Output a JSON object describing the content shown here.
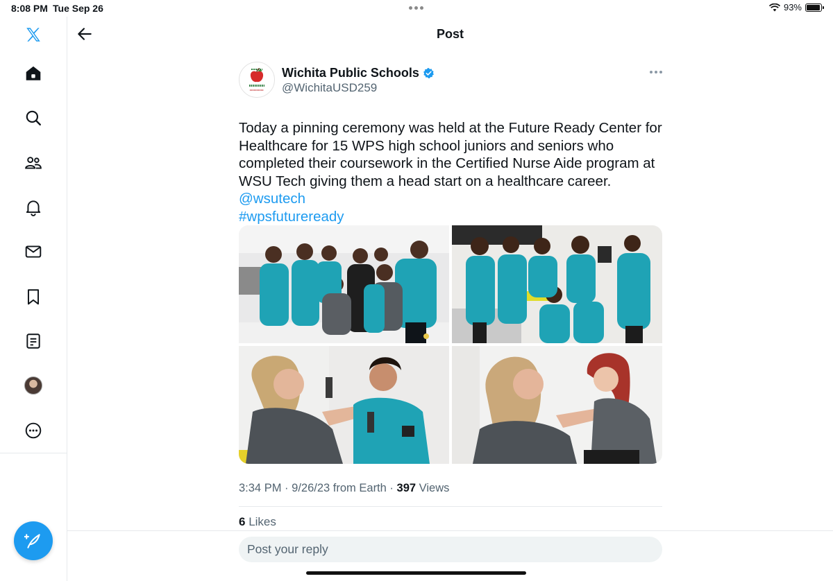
{
  "status_bar": {
    "time": "8:08 PM",
    "date": "Tue Sep 26",
    "battery": "93%",
    "battery_level": 0.93
  },
  "sidebar": {
    "items": [
      {
        "icon": "x-logo-icon"
      },
      {
        "icon": "home-icon"
      },
      {
        "icon": "search-icon"
      },
      {
        "icon": "communities-icon"
      },
      {
        "icon": "bell-icon"
      },
      {
        "icon": "mail-icon"
      },
      {
        "icon": "bookmark-icon"
      },
      {
        "icon": "lists-icon"
      },
      {
        "icon": "profile-avatar"
      },
      {
        "icon": "more-icon"
      }
    ],
    "compose_icon": "compose-feather-icon"
  },
  "header": {
    "title": "Post"
  },
  "tweet": {
    "author_name": "Wichita Public Schools",
    "author_handle": "@WichitaUSD259",
    "verified": true,
    "text": "Today a pinning ceremony was held at the Future Ready Center for Healthcare for 15 WPS high school juniors and seniors who completed their coursework in the Certified Nurse Aide program at WSU Tech giving them a head start on a healthcare career.",
    "mention": "@wsutech",
    "hashtag": "#wpsfutureready",
    "media": [
      {
        "icon": "photo-group-students"
      },
      {
        "icon": "photo-group-students-2"
      },
      {
        "icon": "photo-pinning-male-student"
      },
      {
        "icon": "photo-pinning-female-student"
      }
    ],
    "time": "3:34 PM",
    "date": "9/26/23",
    "source": "from Earth",
    "views_count": "397",
    "views_label": "Views",
    "likes_count": "6",
    "likes_label": "Likes"
  },
  "reply": {
    "placeholder": "Post your reply"
  },
  "colors": {
    "accent": "#1d9bf0",
    "text": "#0f1419",
    "secondary": "#536471",
    "scrub": "#1fa3b5"
  }
}
